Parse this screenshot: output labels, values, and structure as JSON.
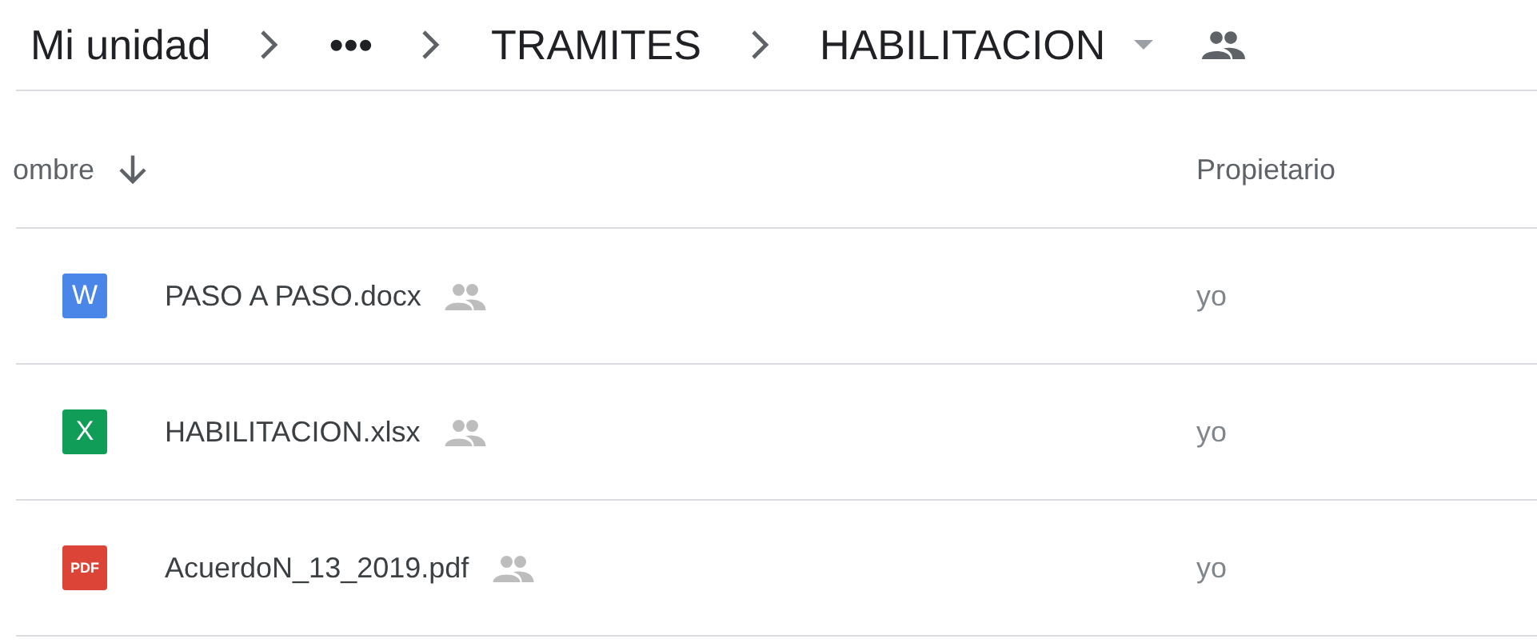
{
  "breadcrumb": [
    {
      "label": "Mi unidad",
      "current": false
    },
    {
      "label": "•••",
      "current": false
    },
    {
      "label": "TRAMITES",
      "current": false
    },
    {
      "label": "HABILITACION",
      "current": true
    }
  ],
  "columns": [
    {
      "label": "ombre",
      "sorted": true
    },
    {
      "label": "Propietario"
    }
  ],
  "files": [
    {
      "kind": "word",
      "badge": "W",
      "name": "PASO A PASO.docx",
      "shared": true,
      "owner": "yo"
    },
    {
      "kind": "excel",
      "badge": "X",
      "name": "HABILITACION.xlsx",
      "shared": true,
      "owner": "yo"
    },
    {
      "kind": "pdf",
      "badge": "PDF",
      "name": "AcuerdoN_13_2019.pdf",
      "shared": true,
      "owner": "yo"
    }
  ]
}
